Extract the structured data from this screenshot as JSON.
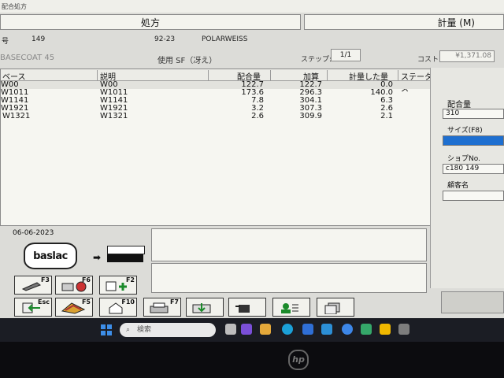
{
  "window": {
    "title": "配合処方"
  },
  "tabs": {
    "prescription": "処方",
    "measure": "計量 (M)"
  },
  "header": {
    "code_prefix": "号",
    "code": "149",
    "color_code": "92-23",
    "color_name": "POLARWEISS",
    "basecoat": "BASECOAT 45",
    "usage": "使用 SF（冴え）",
    "step_label": "ステップ:",
    "step_value": "1/1",
    "cost_label": "コスト",
    "cost_value": "¥1,371.08"
  },
  "table": {
    "columns": [
      "ベース",
      "説明",
      "配合量",
      "加算",
      "計量した量",
      "ステータス"
    ],
    "rows": [
      {
        "base": "W00",
        "desc": "W00",
        "amount": "122.7",
        "added": "122.7",
        "measured": "0.0",
        "status": ""
      },
      {
        "base": "W1011",
        "desc": "W1011",
        "amount": "173.6",
        "added": "296.3",
        "measured": "140.0",
        "status": ""
      },
      {
        "base": "W1141",
        "desc": "W1141",
        "amount": "7.8",
        "added": "304.1",
        "measured": "6.3",
        "status": ""
      },
      {
        "base": "W1921",
        "desc": "W1921",
        "amount": "3.2",
        "added": "307.3",
        "measured": "2.6",
        "status": ""
      },
      {
        "base": "W1321",
        "desc": "W1321",
        "amount": "2.6",
        "added": "309.9",
        "measured": "2.1",
        "status": ""
      }
    ]
  },
  "right_panel": {
    "amount_label": "配合量",
    "amount_value": "310",
    "size_label": "サイズ(F8)",
    "size_value": "",
    "shop_no_label": "ショプNo.",
    "shop_no_value": "c180 149",
    "customer_label": "顧客名",
    "customer_value": ""
  },
  "footer": {
    "date": "06-06-2023",
    "logo_text": "baslac"
  },
  "fkeys": {
    "f3": "F3",
    "f6": "F6",
    "f2": "F2",
    "esc": "Esc",
    "f5": "F5",
    "f10": "F10",
    "f7": "F7"
  },
  "taskbar": {
    "search_placeholder": "検索"
  },
  "laptop": {
    "brand": "hp"
  },
  "colors": {
    "screen_bg": "#dcdcd8",
    "taskbar": "#1b1d24",
    "size_field": "#1e6fd0"
  }
}
